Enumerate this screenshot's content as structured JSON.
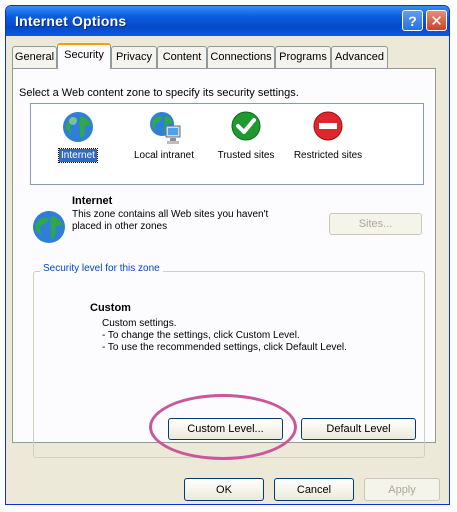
{
  "window": {
    "title": "Internet Options"
  },
  "tabs": [
    {
      "label": "General"
    },
    {
      "label": "Security"
    },
    {
      "label": "Privacy"
    },
    {
      "label": "Content"
    },
    {
      "label": "Connections"
    },
    {
      "label": "Programs"
    },
    {
      "label": "Advanced"
    }
  ],
  "security": {
    "instruction": "Select a Web content zone to specify its security settings.",
    "zones": [
      {
        "label": "Internet",
        "icon": "globe-icon",
        "selected": true
      },
      {
        "label": "Local intranet",
        "icon": "local-intranet-icon"
      },
      {
        "label": "Trusted sites",
        "icon": "checkmark-icon"
      },
      {
        "label": "Restricted sites",
        "icon": "no-entry-icon"
      }
    ],
    "zone_info": {
      "name": "Internet",
      "description": "This zone contains all Web sites you haven't placed in other zones",
      "sites_button": "Sites..."
    },
    "level_group": {
      "title": "Security level for this zone",
      "level_name": "Custom",
      "description_lines": [
        "Custom settings.",
        "- To change the settings, click Custom Level.",
        "- To use the recommended settings, click Default Level."
      ],
      "custom_level_button": "Custom Level...",
      "default_level_button": "Default Level"
    }
  },
  "buttons": {
    "ok": "OK",
    "cancel": "Cancel",
    "apply": "Apply"
  },
  "colors": {
    "titlebar": "#0a5de0",
    "highlight_ring": "#c9589b",
    "selection": "#316ac5"
  }
}
